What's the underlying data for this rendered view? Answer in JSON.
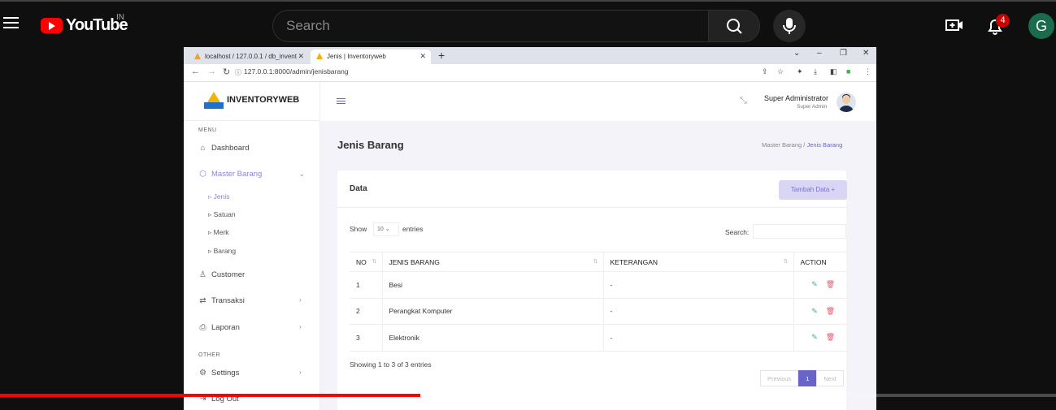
{
  "youtube": {
    "logo_text": "YouTube",
    "country": "IN",
    "search_placeholder": "Search",
    "notification_count": "4",
    "avatar_letter": "G",
    "progress_fraction": 0.398
  },
  "browser": {
    "tabs": [
      {
        "label": "localhost / 127.0.0.1 / db_invent"
      },
      {
        "label": "Jenis | Inventoryweb"
      }
    ],
    "url": "127.0.0.1:8000/admin/jenisbarang"
  },
  "app": {
    "brand": "INVENTORYWEB",
    "sidebar": {
      "menu_heading": "MENU",
      "other_heading": "OTHER",
      "items": [
        {
          "label": "Dashboard",
          "icon": "home-icon"
        },
        {
          "label": "Master Barang",
          "icon": "cube-icon"
        },
        {
          "label": "Customer",
          "icon": "user-icon"
        },
        {
          "label": "Transaksi",
          "icon": "exchange-icon"
        },
        {
          "label": "Laporan",
          "icon": "printer-icon"
        },
        {
          "label": "Settings",
          "icon": "gear-icon"
        },
        {
          "label": "Log Out",
          "icon": "logout-icon"
        }
      ],
      "sub_items": [
        {
          "label": "Jenis"
        },
        {
          "label": "Satuan"
        },
        {
          "label": "Merk"
        },
        {
          "label": "Barang"
        }
      ]
    },
    "topbar": {
      "user_name": "Super Administrator",
      "user_role": "Super Admin"
    },
    "page": {
      "title": "Jenis Barang",
      "breadcrumb_parent": "Master Barang",
      "breadcrumb_current": "Jenis Barang"
    },
    "card": {
      "title": "Data",
      "add_button": "Tambah Data +",
      "show_label": "Show",
      "show_value": "10",
      "entries_label": "entries",
      "search_label": "Search:",
      "columns": [
        "NO",
        "JENIS BARANG",
        "KETERANGAN",
        "ACTION"
      ],
      "rows": [
        {
          "no": "1",
          "jenis": "Besi",
          "keterangan": "-"
        },
        {
          "no": "2",
          "jenis": "Perangkat Komputer",
          "keterangan": "-"
        },
        {
          "no": "3",
          "jenis": "Elektronik",
          "keterangan": "-"
        }
      ],
      "info": "Showing 1 to 3 of 3 entries",
      "pager": {
        "prev": "Previous",
        "current": "1",
        "next": "Next"
      }
    }
  },
  "colors": {
    "accent": "#6a63c9",
    "youtube_red": "#ff0000"
  }
}
